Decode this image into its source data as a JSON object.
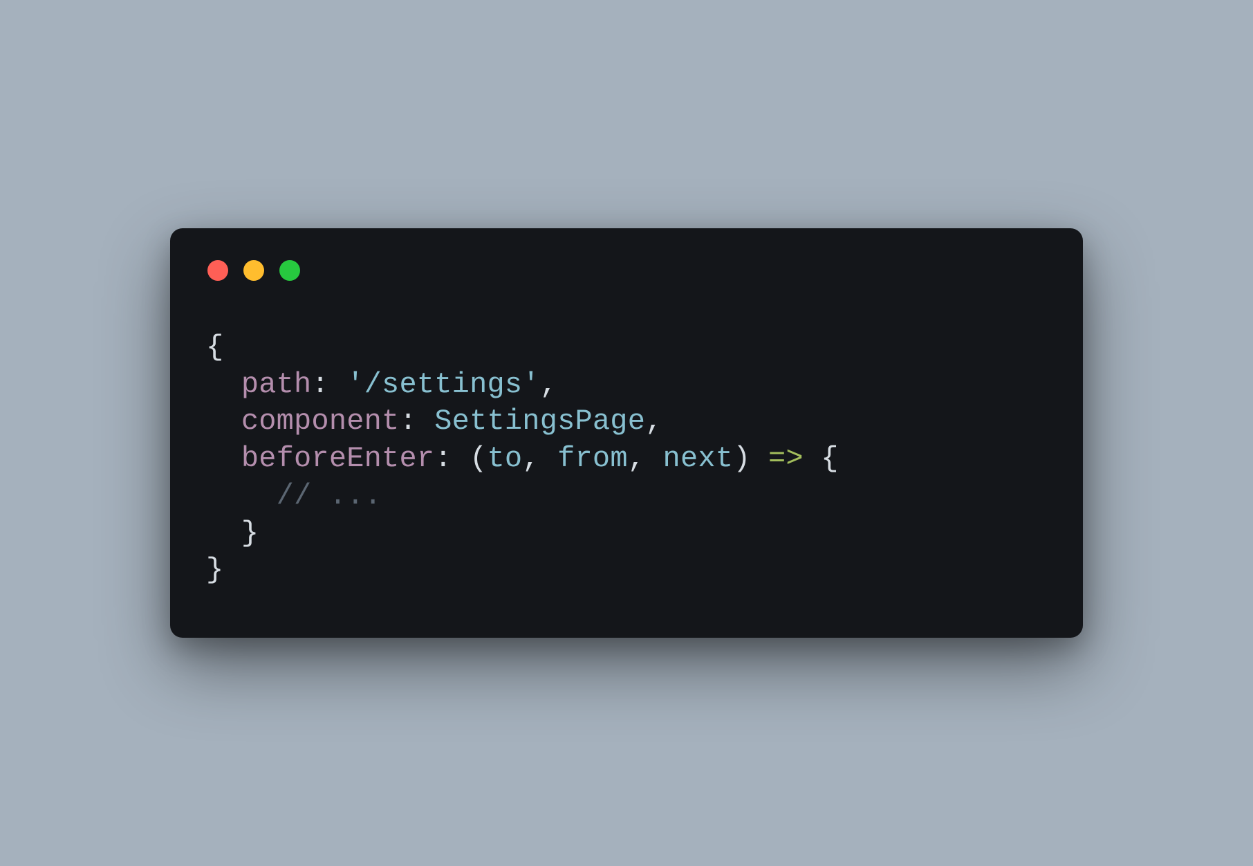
{
  "code": {
    "indent1": "  ",
    "indent2": "    ",
    "brace_open": "{",
    "brace_close": "}",
    "paren_open": "(",
    "paren_close": ")",
    "colon_sp": ": ",
    "comma": ",",
    "comma_sp": ", ",
    "sp": " ",
    "key_path": "path",
    "val_path": "'/settings'",
    "key_component": "component",
    "val_component": "SettingsPage",
    "key_beforeEnter": "beforeEnter",
    "param_to": "to",
    "param_from": "from",
    "param_next": "next",
    "arrow": "=>",
    "comment": "// ..."
  }
}
